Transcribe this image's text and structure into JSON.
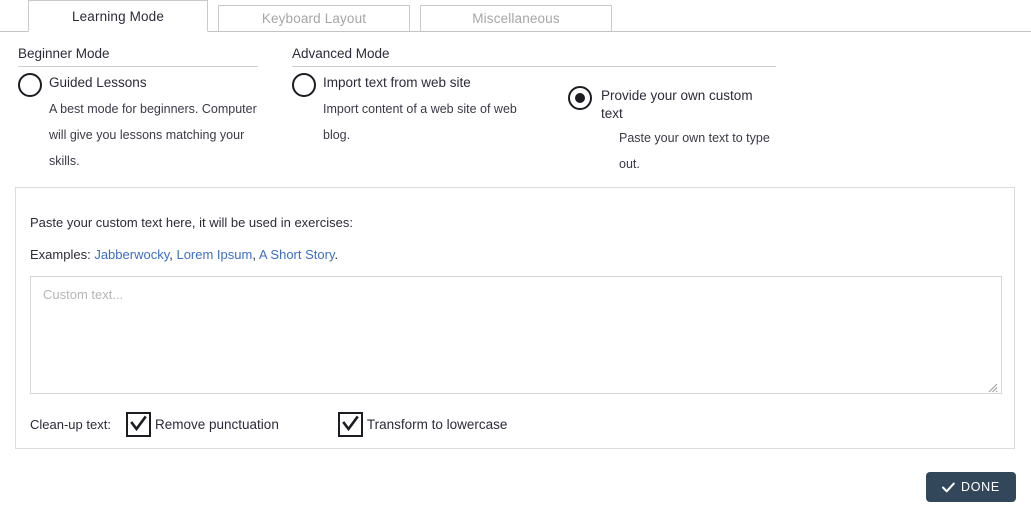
{
  "tabs": [
    {
      "id": "learning-mode",
      "label": "Learning Mode",
      "active": true
    },
    {
      "id": "keyboard-layout",
      "label": "Keyboard Layout",
      "active": false
    },
    {
      "id": "miscellaneous",
      "label": "Miscellaneous",
      "active": false
    }
  ],
  "beginner": {
    "heading": "Beginner Mode",
    "option": {
      "title": "Guided Lessons",
      "description": "A best mode for beginners. Computer will give you lessons matching your skills.",
      "selected": false
    }
  },
  "advanced": {
    "heading": "Advanced Mode",
    "import_option": {
      "title": "Import text from web site",
      "description": "Import content of a web site of web blog.",
      "selected": false
    },
    "custom_option": {
      "title": "Provide your own custom text",
      "description": "Paste your own text to type out.",
      "selected": true
    }
  },
  "panel": {
    "instruction": "Paste your custom text here, it will be used in exercises:",
    "examples_label": "Examples:",
    "example_links": [
      "Jabberwocky",
      "Lorem Ipsum",
      "A Short Story"
    ],
    "examples_separator": ", ",
    "examples_terminator": ".",
    "textarea": {
      "placeholder": "Custom text...",
      "value": ""
    },
    "cleanup": {
      "label": "Clean-up text:",
      "options": [
        {
          "label": "Remove punctuation",
          "checked": true
        },
        {
          "label": "Transform to lowercase",
          "checked": true
        }
      ]
    }
  },
  "footer": {
    "done_label": "DONE",
    "done_icon": "check-icon"
  },
  "colors": {
    "accent_link": "#3d6ec5",
    "button_bg": "#33475b",
    "tab_inactive_text": "#a6a6a6",
    "border": "#dcdcdc",
    "control_outline": "#1c1c22"
  }
}
